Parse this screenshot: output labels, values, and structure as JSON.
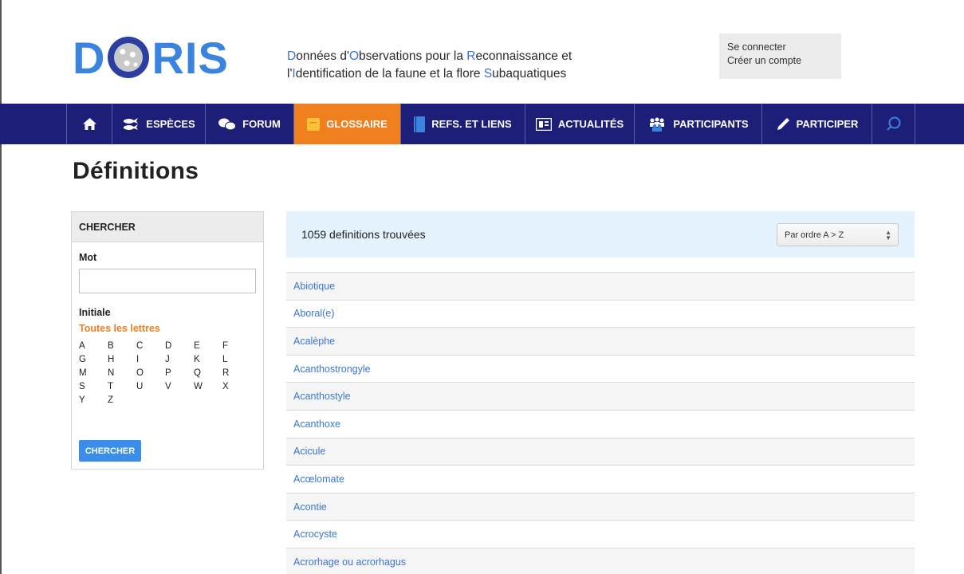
{
  "header": {
    "logo": {
      "letters": [
        "D",
        "R",
        "I",
        "S"
      ]
    },
    "tagline": {
      "line1": [
        {
          "t": "D",
          "hl": true
        },
        {
          "t": "onnées d'",
          "hl": false
        },
        {
          "t": "O",
          "hl": true
        },
        {
          "t": "bservations pour la ",
          "hl": false
        },
        {
          "t": "R",
          "hl": true
        },
        {
          "t": "econnaissance et",
          "hl": false
        }
      ],
      "line2": [
        {
          "t": "l'",
          "hl": false
        },
        {
          "t": "I",
          "hl": true
        },
        {
          "t": "dentification de la faune et la flore ",
          "hl": false
        },
        {
          "t": "S",
          "hl": true
        },
        {
          "t": "ubaquatiques",
          "hl": false
        }
      ]
    },
    "login": {
      "connect": "Se connecter",
      "create": "Créer un compte"
    }
  },
  "nav": {
    "home_icon": "home-icon",
    "items": [
      {
        "label": "ESPÈCES",
        "icon": "fish-icon"
      },
      {
        "label": "FORUM",
        "icon": "chat-icon"
      },
      {
        "label": "GLOSSAIRE",
        "icon": "glossary-icon",
        "active": true
      },
      {
        "label": "REFS. ET LIENS",
        "icon": "book-icon"
      },
      {
        "label": "ACTUALITÉS",
        "icon": "news-icon"
      },
      {
        "label": "PARTICIPANTS",
        "icon": "people-icon"
      },
      {
        "label": "PARTICIPER",
        "icon": "pen-icon"
      }
    ],
    "search_icon": "search-icon"
  },
  "page_title": "Définitions",
  "sidebar": {
    "heading": "CHERCHER",
    "word_label": "Mot",
    "word_value": "",
    "initial_label": "Initiale",
    "all_letters": "Toutes les lettres",
    "letters": [
      "A",
      "B",
      "C",
      "D",
      "E",
      "F",
      "G",
      "H",
      "I",
      "J",
      "K",
      "L",
      "M",
      "N",
      "O",
      "P",
      "Q",
      "R",
      "S",
      "T",
      "U",
      "V",
      "W",
      "X",
      "Y",
      "Z"
    ],
    "button": "CHERCHER"
  },
  "results": {
    "count_text": "1059 definitions trouvées",
    "sort_selected": "Par ordre A > Z",
    "items": [
      "Abiotique",
      "Aboral(e)",
      "Acalèphe",
      "Acanthostrongyle",
      "Acanthostyle",
      "Acanthoxe",
      "Acicule",
      "Acœlomate",
      "Acontie",
      "Acrocyste",
      "Acrorhage ou acrorhagus"
    ]
  },
  "colors": {
    "nav_bg": "#1c1e78",
    "active_tab": "#f07f1e",
    "link": "#3a77d6",
    "logo_blue": "#3a84e0",
    "results_bar": "#e3f2fd",
    "button": "#3a8de8"
  }
}
